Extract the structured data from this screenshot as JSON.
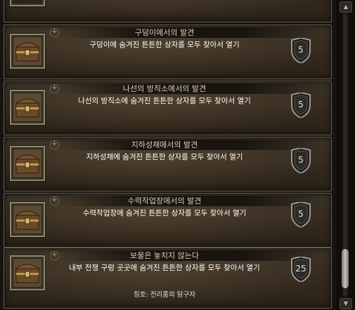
{
  "achievements": [
    {
      "title": "구덩이에서의 발견",
      "description": "구덩이에 숨겨진 튼튼한 상자를 모두 찾아서 열기",
      "points": "5"
    },
    {
      "title": "나선의 방직소에서의 발견",
      "description": "나선의 방직소에 숨겨진 튼튼한 상자를 모두 찾아서 열기",
      "points": "5"
    },
    {
      "title": "지하성채에서의 발견",
      "description": "지하성채에 숨겨진 튼튼한 상자를 모두 찾아서 열기",
      "points": "5"
    },
    {
      "title": "수력작업장에서의 발견",
      "description": "수력작업장에 숨겨진 튼튼한 상자를 모두 찾아서 열기",
      "points": "5"
    },
    {
      "title": "보물은 놓치지 않는다",
      "description": "내부 전쟁 구렁 곳곳에 숨겨진 튼튼한 상자를 모두 찾아서 열기",
      "points": "25",
      "reward": "칭호: 전리품의 탐구자"
    }
  ],
  "icons": {
    "achievement": "treasure-chest-icon",
    "expand": "plus-icon",
    "points": "shield-icon",
    "scroll_up": "arrow-up-icon",
    "scroll_down": "arrow-down-icon"
  },
  "colors": {
    "title_text": "#d6cdbd",
    "description_text": "#ffffff",
    "card_border": "#6b5f48"
  }
}
